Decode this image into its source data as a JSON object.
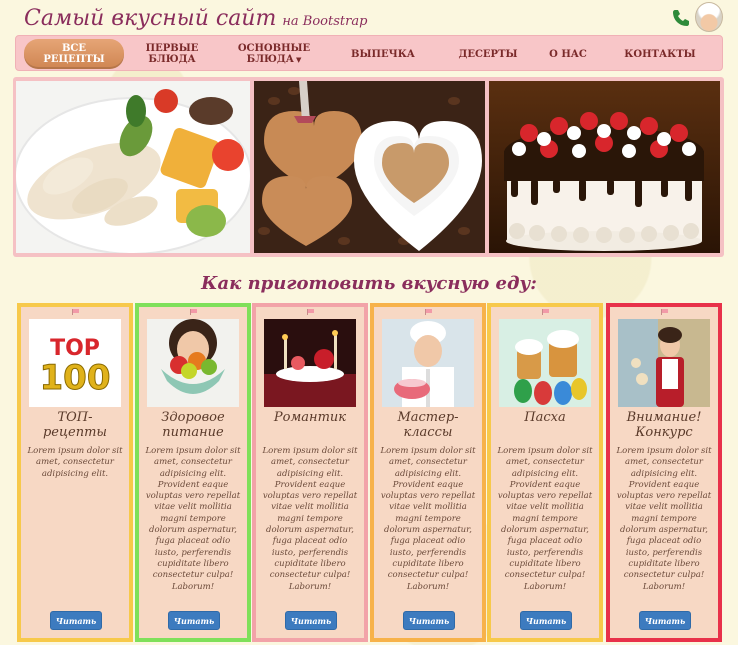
{
  "header": {
    "title": "Самый вкусный сайт",
    "subtitle": "на Bootstrap",
    "icons": [
      "phone-icon",
      "chef-avatar"
    ]
  },
  "nav": {
    "items": [
      {
        "label": "ВСЕ\nРЕЦЕПТЫ",
        "active": true
      },
      {
        "label": "ПЕРВЫЕ\nБЛЮДА"
      },
      {
        "label": "ОСНОВНЫЕ\nБЛЮДА",
        "dropdown": true
      },
      {
        "label": "ВЫПЕЧКА"
      },
      {
        "label": "ДЕСЕРТЫ"
      },
      {
        "label": "О НАС"
      },
      {
        "label": "КОНТАКТЫ"
      }
    ]
  },
  "section_heading": "Как приготовить вкусную еду:",
  "colors": {
    "title": "#8a2d5c",
    "navbar": "#f8c6c8",
    "active_nav": "#d88b5a",
    "button": "#3d7bbf",
    "card_bg": "#f7d8c4"
  },
  "cards": [
    {
      "title": "ТОП-\nрецепты",
      "border": "#f7c94a",
      "photo": "top100"
    },
    {
      "title": "Здоровое\nпитание",
      "border": "#7fe05a",
      "photo": "healthy"
    },
    {
      "title": "Романтик",
      "border": "#f2a3a8",
      "photo": "romantic"
    },
    {
      "title": "Мастер-\nклассы",
      "border": "#f7b24a",
      "photo": "chef"
    },
    {
      "title": "Пасха",
      "border": "#f7c94a",
      "photo": "easter"
    },
    {
      "title": "Внимание!\nКонкурс",
      "border": "#e8314a",
      "photo": "contest"
    }
  ],
  "card_text": "Lorem ipsum dolor sit amet, consectetur adipisicing elit.",
  "card_text_long": "Lorem ipsum dolor sit amet, consectetur adipisicing elit. Provident eaque voluptas vero repellat vitae velit mollitia magni tempore dolorum aspernatur, fuga placeat odio iusto, perferendis cupiditate libero consectetur culpa! Laborum!",
  "read_button_label": "Читать"
}
